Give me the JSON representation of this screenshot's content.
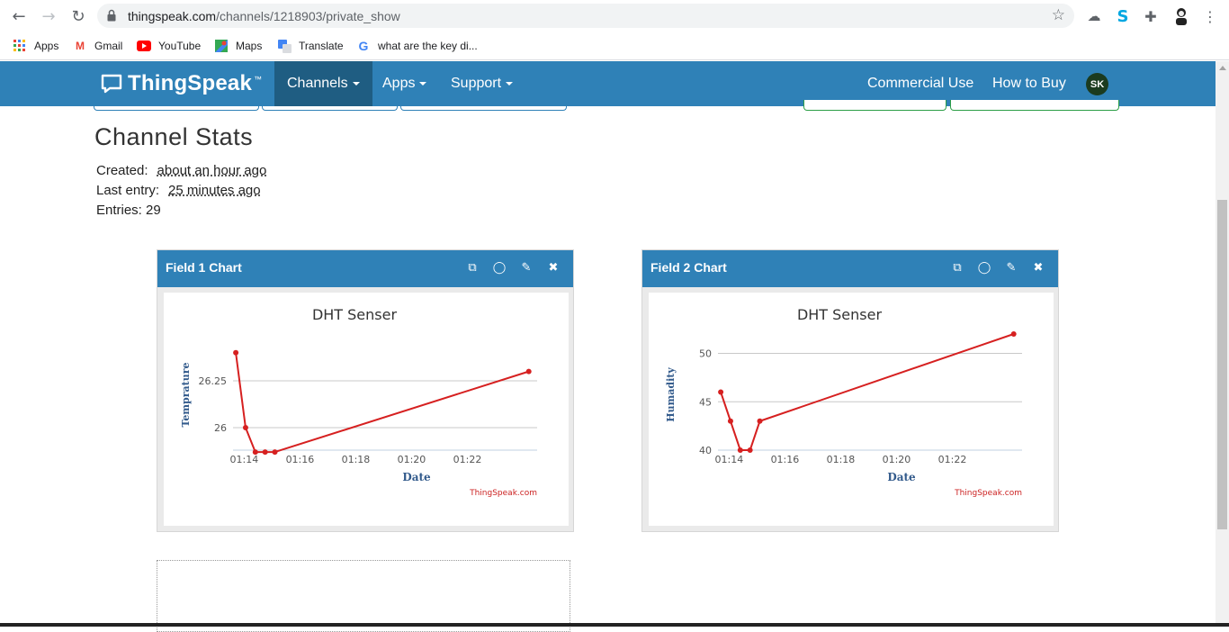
{
  "browser": {
    "url_host": "thingspeak.com",
    "url_path": "/channels/1218903/private_show",
    "bookmarks": [
      {
        "label": "Apps"
      },
      {
        "label": "Gmail"
      },
      {
        "label": "YouTube"
      },
      {
        "label": "Maps"
      },
      {
        "label": "Translate"
      },
      {
        "label": "what are the key di..."
      }
    ]
  },
  "nav": {
    "brand": "ThingSpeak",
    "brand_tm": "™",
    "channels": "Channels",
    "apps": "Apps",
    "support": "Support",
    "commercial_use": "Commercial Use",
    "how_to_buy": "How to Buy",
    "avatar": "SK"
  },
  "stats": {
    "title": "Channel Stats",
    "created_label": "Created:",
    "created_value": "about an hour ago",
    "last_entry_label": "Last entry:",
    "last_entry_value": "25 minutes ago",
    "entries_label": "Entries: 29"
  },
  "colors": {
    "nav_bg": "#2f81b7",
    "nav_active": "#1f5d82",
    "series": "#d62020",
    "axis_title": "#335b8c"
  },
  "charts": [
    {
      "panel_title": "Field 1 Chart",
      "title": "DHT Senser",
      "xlabel": "Date",
      "ylabel": "Temprature",
      "credit": "ThingSpeak.com",
      "xticks": [
        "01:14",
        "01:16",
        "01:18",
        "01:20",
        "01:22"
      ],
      "yticks": [
        "26",
        "26.25"
      ]
    },
    {
      "panel_title": "Field 2 Chart",
      "title": "DHT Senser",
      "xlabel": "Date",
      "ylabel": "Humadity",
      "credit": "ThingSpeak.com",
      "xticks": [
        "01:14",
        "01:16",
        "01:18",
        "01:20",
        "01:22"
      ],
      "yticks": [
        "40",
        "45",
        "50"
      ]
    }
  ],
  "chart_data": [
    {
      "type": "line",
      "title": "DHT Senser",
      "xlabel": "Date",
      "ylabel": "Temprature",
      "ylim": [
        25.88,
        26.5
      ],
      "xlim": [
        "01:13.6",
        "01:24.5"
      ],
      "yticks": [
        26,
        26.25
      ],
      "xticks": [
        "01:14",
        "01:16",
        "01:18",
        "01:20",
        "01:22"
      ],
      "grid": true,
      "series": [
        {
          "x": [
            "01:13.7",
            "01:14.05",
            "01:14.4",
            "01:14.75",
            "01:15.1",
            "01:24.2"
          ],
          "y": [
            26.4,
            26.0,
            25.87,
            25.87,
            25.87,
            26.3
          ]
        }
      ]
    },
    {
      "type": "line",
      "title": "DHT Senser",
      "xlabel": "Date",
      "ylabel": "Humadity",
      "ylim": [
        40,
        52
      ],
      "xlim": [
        "01:13.6",
        "01:24.5"
      ],
      "yticks": [
        40,
        45,
        50
      ],
      "xticks": [
        "01:14",
        "01:16",
        "01:18",
        "01:20",
        "01:22"
      ],
      "grid": true,
      "series": [
        {
          "x": [
            "01:13.7",
            "01:14.05",
            "01:14.4",
            "01:14.75",
            "01:15.1",
            "01:24.2"
          ],
          "y": [
            46,
            43,
            40,
            40,
            43,
            52
          ]
        }
      ]
    }
  ]
}
